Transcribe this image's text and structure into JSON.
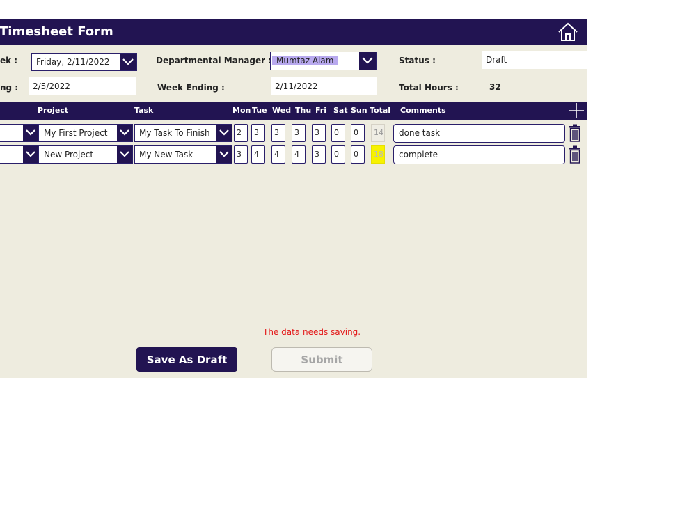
{
  "app": {
    "title": "Timesheet Form",
    "colors": {
      "header": "#221452",
      "background": "#eeecdf",
      "error": "#e31b1b",
      "total_highlight": "#f7f200"
    }
  },
  "header": {
    "week_label": "ek :",
    "week_value": "Friday, 2/11/2022",
    "week_starting_label": "ng :",
    "week_starting_value": "2/5/2022",
    "manager_label": "Departmental Manager :",
    "manager_value": "Mumtaz Alam",
    "week_ending_label": "Week Ending :",
    "week_ending_value": "2/11/2022",
    "status_label": "Status :",
    "status_value": "Draft",
    "total_hours_label": "Total Hours :",
    "total_hours_value": "32"
  },
  "table": {
    "columns": {
      "project": "Project",
      "task": "Task",
      "mon": "Mon",
      "tue": "Tue",
      "wed": "Wed",
      "thu": "Thu",
      "fri": "Fri",
      "sat": "Sat",
      "sun": "Sun",
      "total": "Total",
      "comments": "Comments"
    },
    "rows": [
      {
        "project": "My First Project",
        "task": "My Task To Finish",
        "mon": "2",
        "tue": "3",
        "wed": "3",
        "thu": "3",
        "fri": "3",
        "sat": "0",
        "sun": "0",
        "total": "14",
        "comment": "done task"
      },
      {
        "project": "New Project",
        "task": "My New Task",
        "mon": "3",
        "tue": "4",
        "wed": "4",
        "thu": "4",
        "fri": "3",
        "sat": "0",
        "sun": "0",
        "total": "18",
        "comment": "complete"
      }
    ]
  },
  "message": "The data needs saving.",
  "buttons": {
    "save_draft": "Save As Draft",
    "submit": "Submit"
  },
  "icons": {
    "home": "home-icon",
    "add": "plus-icon",
    "delete": "trash-icon",
    "dropdown": "chevron-down-icon"
  }
}
